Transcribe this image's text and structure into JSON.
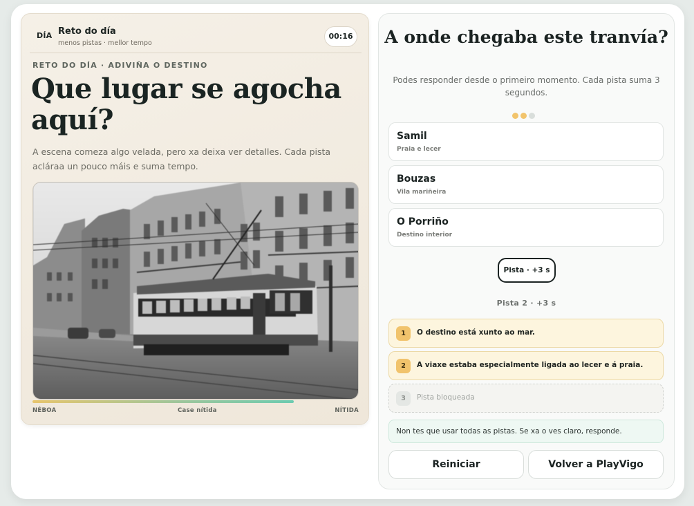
{
  "header": {
    "day_tag": "DÍA",
    "title": "Reto do día",
    "subtitle": "menos pistas · mellor tempo",
    "timer": "00:16"
  },
  "puzzle": {
    "eyebrow": "RETO DO DÍA · ADIVIÑA O DESTINO",
    "title": "Que lugar se agocha aquí?",
    "lead": "A escena comeza algo velada, pero xa deixa ver detalles. Cada pista acláraa un pouco máis e suma tempo.",
    "clarity_progress": 0.8,
    "clarity_labels": {
      "start": "NÉBOA",
      "middle": "Case nítida",
      "end": "NÍTIDA"
    }
  },
  "question": {
    "title": "A onde chegaba este tranvía?",
    "subtitle": "Podes responder desde o primeiro momento. Cada pista suma 3 segundos.",
    "dots": [
      "used",
      "used",
      "empty"
    ]
  },
  "options": [
    {
      "name": "Samil",
      "desc": "Praia e lecer"
    },
    {
      "name": "Bouzas",
      "desc": "Vila mariñeira"
    },
    {
      "name": "O Porriño",
      "desc": "Destino interior"
    }
  ],
  "hint_button": "Pista · +3 s",
  "hint_count": "Pista 2 · +3 s",
  "clues": [
    {
      "num": "1",
      "text": "O destino está xunto ao mar.",
      "state": "open"
    },
    {
      "num": "2",
      "text": "A viaxe estaba especialmente ligada ao lecer e á praia.",
      "state": "open"
    },
    {
      "num": "3",
      "text": "Pista bloqueada",
      "state": "locked"
    }
  ],
  "note": "Non tes que usar todas as pistas. Se xa o ves claro, responde.",
  "actions": {
    "restart": "Reiniciar",
    "back": "Volver a PlayVigo"
  },
  "colors": {
    "accent_gold": "#f1c36c",
    "accent_teal": "#6ccbb0",
    "dot_used": "#f2c46c",
    "dot_empty": "#d9dedb"
  }
}
